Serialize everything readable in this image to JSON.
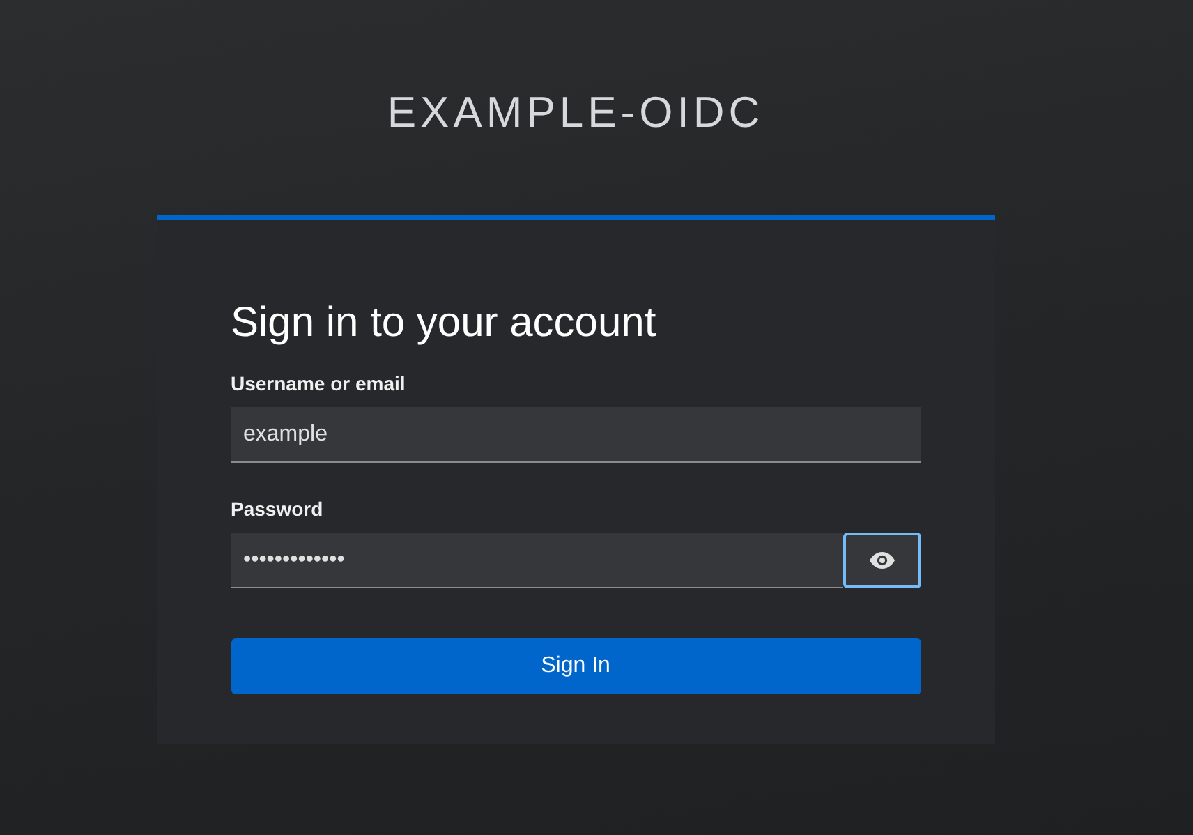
{
  "realm_title": "EXAMPLE-OIDC",
  "form": {
    "heading": "Sign in to your account",
    "fields": [
      {
        "label": "Username or email",
        "value": "example",
        "kind": "text"
      },
      {
        "label": "Password",
        "value": "•••••••••••••",
        "kind": "password",
        "reveal_focused": true
      }
    ],
    "submit": "Sign In"
  }
}
